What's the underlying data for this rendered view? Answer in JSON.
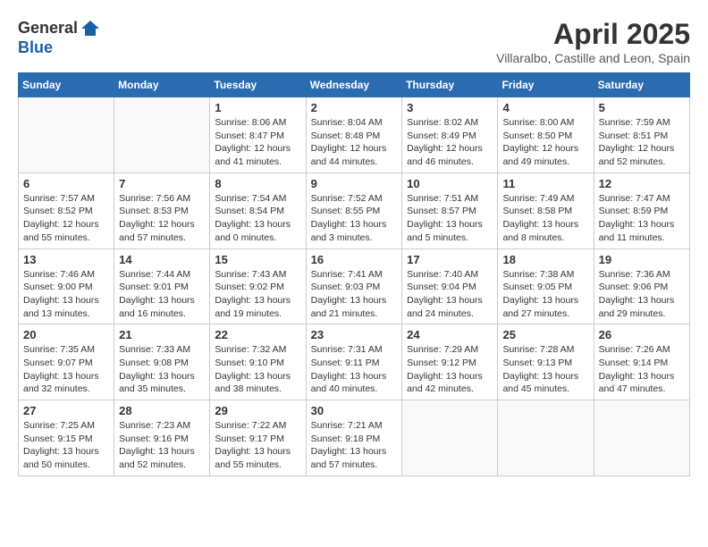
{
  "header": {
    "logo_general": "General",
    "logo_blue": "Blue",
    "month_title": "April 2025",
    "location": "Villaralbo, Castille and Leon, Spain"
  },
  "days_of_week": [
    "Sunday",
    "Monday",
    "Tuesday",
    "Wednesday",
    "Thursday",
    "Friday",
    "Saturday"
  ],
  "weeks": [
    [
      {
        "day": "",
        "sunrise": "",
        "sunset": "",
        "daylight": ""
      },
      {
        "day": "",
        "sunrise": "",
        "sunset": "",
        "daylight": ""
      },
      {
        "day": "1",
        "sunrise": "Sunrise: 8:06 AM",
        "sunset": "Sunset: 8:47 PM",
        "daylight": "Daylight: 12 hours and 41 minutes."
      },
      {
        "day": "2",
        "sunrise": "Sunrise: 8:04 AM",
        "sunset": "Sunset: 8:48 PM",
        "daylight": "Daylight: 12 hours and 44 minutes."
      },
      {
        "day": "3",
        "sunrise": "Sunrise: 8:02 AM",
        "sunset": "Sunset: 8:49 PM",
        "daylight": "Daylight: 12 hours and 46 minutes."
      },
      {
        "day": "4",
        "sunrise": "Sunrise: 8:00 AM",
        "sunset": "Sunset: 8:50 PM",
        "daylight": "Daylight: 12 hours and 49 minutes."
      },
      {
        "day": "5",
        "sunrise": "Sunrise: 7:59 AM",
        "sunset": "Sunset: 8:51 PM",
        "daylight": "Daylight: 12 hours and 52 minutes."
      }
    ],
    [
      {
        "day": "6",
        "sunrise": "Sunrise: 7:57 AM",
        "sunset": "Sunset: 8:52 PM",
        "daylight": "Daylight: 12 hours and 55 minutes."
      },
      {
        "day": "7",
        "sunrise": "Sunrise: 7:56 AM",
        "sunset": "Sunset: 8:53 PM",
        "daylight": "Daylight: 12 hours and 57 minutes."
      },
      {
        "day": "8",
        "sunrise": "Sunrise: 7:54 AM",
        "sunset": "Sunset: 8:54 PM",
        "daylight": "Daylight: 13 hours and 0 minutes."
      },
      {
        "day": "9",
        "sunrise": "Sunrise: 7:52 AM",
        "sunset": "Sunset: 8:55 PM",
        "daylight": "Daylight: 13 hours and 3 minutes."
      },
      {
        "day": "10",
        "sunrise": "Sunrise: 7:51 AM",
        "sunset": "Sunset: 8:57 PM",
        "daylight": "Daylight: 13 hours and 5 minutes."
      },
      {
        "day": "11",
        "sunrise": "Sunrise: 7:49 AM",
        "sunset": "Sunset: 8:58 PM",
        "daylight": "Daylight: 13 hours and 8 minutes."
      },
      {
        "day": "12",
        "sunrise": "Sunrise: 7:47 AM",
        "sunset": "Sunset: 8:59 PM",
        "daylight": "Daylight: 13 hours and 11 minutes."
      }
    ],
    [
      {
        "day": "13",
        "sunrise": "Sunrise: 7:46 AM",
        "sunset": "Sunset: 9:00 PM",
        "daylight": "Daylight: 13 hours and 13 minutes."
      },
      {
        "day": "14",
        "sunrise": "Sunrise: 7:44 AM",
        "sunset": "Sunset: 9:01 PM",
        "daylight": "Daylight: 13 hours and 16 minutes."
      },
      {
        "day": "15",
        "sunrise": "Sunrise: 7:43 AM",
        "sunset": "Sunset: 9:02 PM",
        "daylight": "Daylight: 13 hours and 19 minutes."
      },
      {
        "day": "16",
        "sunrise": "Sunrise: 7:41 AM",
        "sunset": "Sunset: 9:03 PM",
        "daylight": "Daylight: 13 hours and 21 minutes."
      },
      {
        "day": "17",
        "sunrise": "Sunrise: 7:40 AM",
        "sunset": "Sunset: 9:04 PM",
        "daylight": "Daylight: 13 hours and 24 minutes."
      },
      {
        "day": "18",
        "sunrise": "Sunrise: 7:38 AM",
        "sunset": "Sunset: 9:05 PM",
        "daylight": "Daylight: 13 hours and 27 minutes."
      },
      {
        "day": "19",
        "sunrise": "Sunrise: 7:36 AM",
        "sunset": "Sunset: 9:06 PM",
        "daylight": "Daylight: 13 hours and 29 minutes."
      }
    ],
    [
      {
        "day": "20",
        "sunrise": "Sunrise: 7:35 AM",
        "sunset": "Sunset: 9:07 PM",
        "daylight": "Daylight: 13 hours and 32 minutes."
      },
      {
        "day": "21",
        "sunrise": "Sunrise: 7:33 AM",
        "sunset": "Sunset: 9:08 PM",
        "daylight": "Daylight: 13 hours and 35 minutes."
      },
      {
        "day": "22",
        "sunrise": "Sunrise: 7:32 AM",
        "sunset": "Sunset: 9:10 PM",
        "daylight": "Daylight: 13 hours and 38 minutes."
      },
      {
        "day": "23",
        "sunrise": "Sunrise: 7:31 AM",
        "sunset": "Sunset: 9:11 PM",
        "daylight": "Daylight: 13 hours and 40 minutes."
      },
      {
        "day": "24",
        "sunrise": "Sunrise: 7:29 AM",
        "sunset": "Sunset: 9:12 PM",
        "daylight": "Daylight: 13 hours and 42 minutes."
      },
      {
        "day": "25",
        "sunrise": "Sunrise: 7:28 AM",
        "sunset": "Sunset: 9:13 PM",
        "daylight": "Daylight: 13 hours and 45 minutes."
      },
      {
        "day": "26",
        "sunrise": "Sunrise: 7:26 AM",
        "sunset": "Sunset: 9:14 PM",
        "daylight": "Daylight: 13 hours and 47 minutes."
      }
    ],
    [
      {
        "day": "27",
        "sunrise": "Sunrise: 7:25 AM",
        "sunset": "Sunset: 9:15 PM",
        "daylight": "Daylight: 13 hours and 50 minutes."
      },
      {
        "day": "28",
        "sunrise": "Sunrise: 7:23 AM",
        "sunset": "Sunset: 9:16 PM",
        "daylight": "Daylight: 13 hours and 52 minutes."
      },
      {
        "day": "29",
        "sunrise": "Sunrise: 7:22 AM",
        "sunset": "Sunset: 9:17 PM",
        "daylight": "Daylight: 13 hours and 55 minutes."
      },
      {
        "day": "30",
        "sunrise": "Sunrise: 7:21 AM",
        "sunset": "Sunset: 9:18 PM",
        "daylight": "Daylight: 13 hours and 57 minutes."
      },
      {
        "day": "",
        "sunrise": "",
        "sunset": "",
        "daylight": ""
      },
      {
        "day": "",
        "sunrise": "",
        "sunset": "",
        "daylight": ""
      },
      {
        "day": "",
        "sunrise": "",
        "sunset": "",
        "daylight": ""
      }
    ]
  ]
}
